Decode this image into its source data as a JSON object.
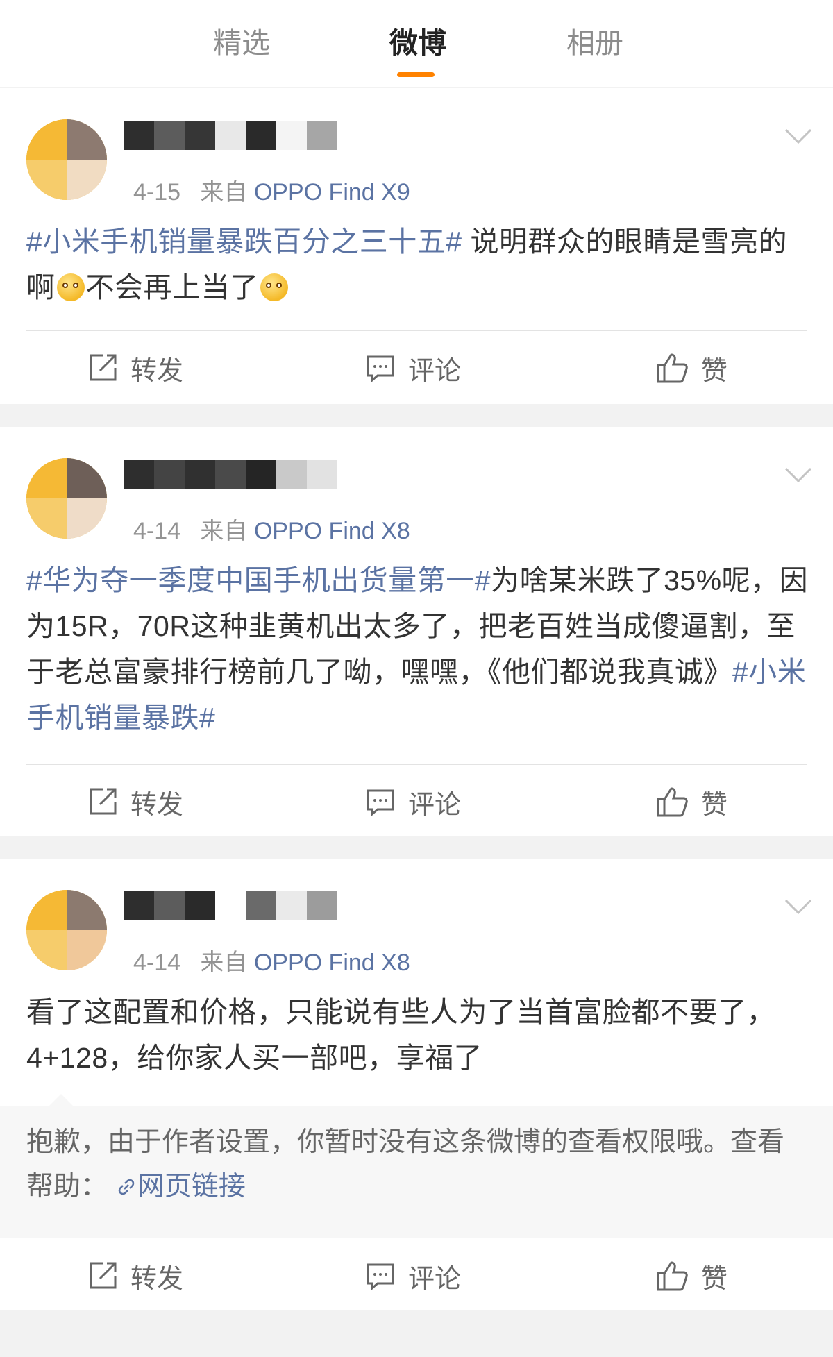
{
  "tabs": [
    {
      "label": "精选",
      "active": false
    },
    {
      "label": "微博",
      "active": true
    },
    {
      "label": "相册",
      "active": false
    }
  ],
  "accent_color": "#ff8200",
  "link_color": "#5b73a3",
  "posts": [
    {
      "date": "4-15",
      "from_label": "来自",
      "source": "OPPO Find X9",
      "topic": "#小米手机销量暴跌百分之三十五#",
      "text_1": " 说明群众的眼睛是雪亮的啊",
      "emoji_1": "smirk-emoji",
      "text_2": "不会再上当了",
      "emoji_2": "smirk-emoji"
    },
    {
      "date": "4-14",
      "from_label": "来自",
      "source": "OPPO Find X8",
      "topic": "#华为夺一季度中国手机出货量第一#",
      "text_1": "为啥某米跌了35%呢，因为15R，70R这种韭黄机出太多了，把老百姓当成傻逼割，至于老总富豪排行榜前几了呦，嘿嘿，《他们都说我真诚》",
      "topic_2": "#小米手机销量暴跌#"
    },
    {
      "date": "4-14",
      "from_label": "来自",
      "source": "OPPO Find X8",
      "text_1": "看了这配置和价格，只能说有些人为了当首富脸都不要了，4+128，给你家人买一部吧，享福了",
      "notice_text": "抱歉，由于作者设置，你暂时没有这条微博的查看权限哦。查看帮助：",
      "notice_link": "网页链接"
    }
  ],
  "actions": {
    "repost": "转发",
    "comment": "评论",
    "like": "赞"
  }
}
